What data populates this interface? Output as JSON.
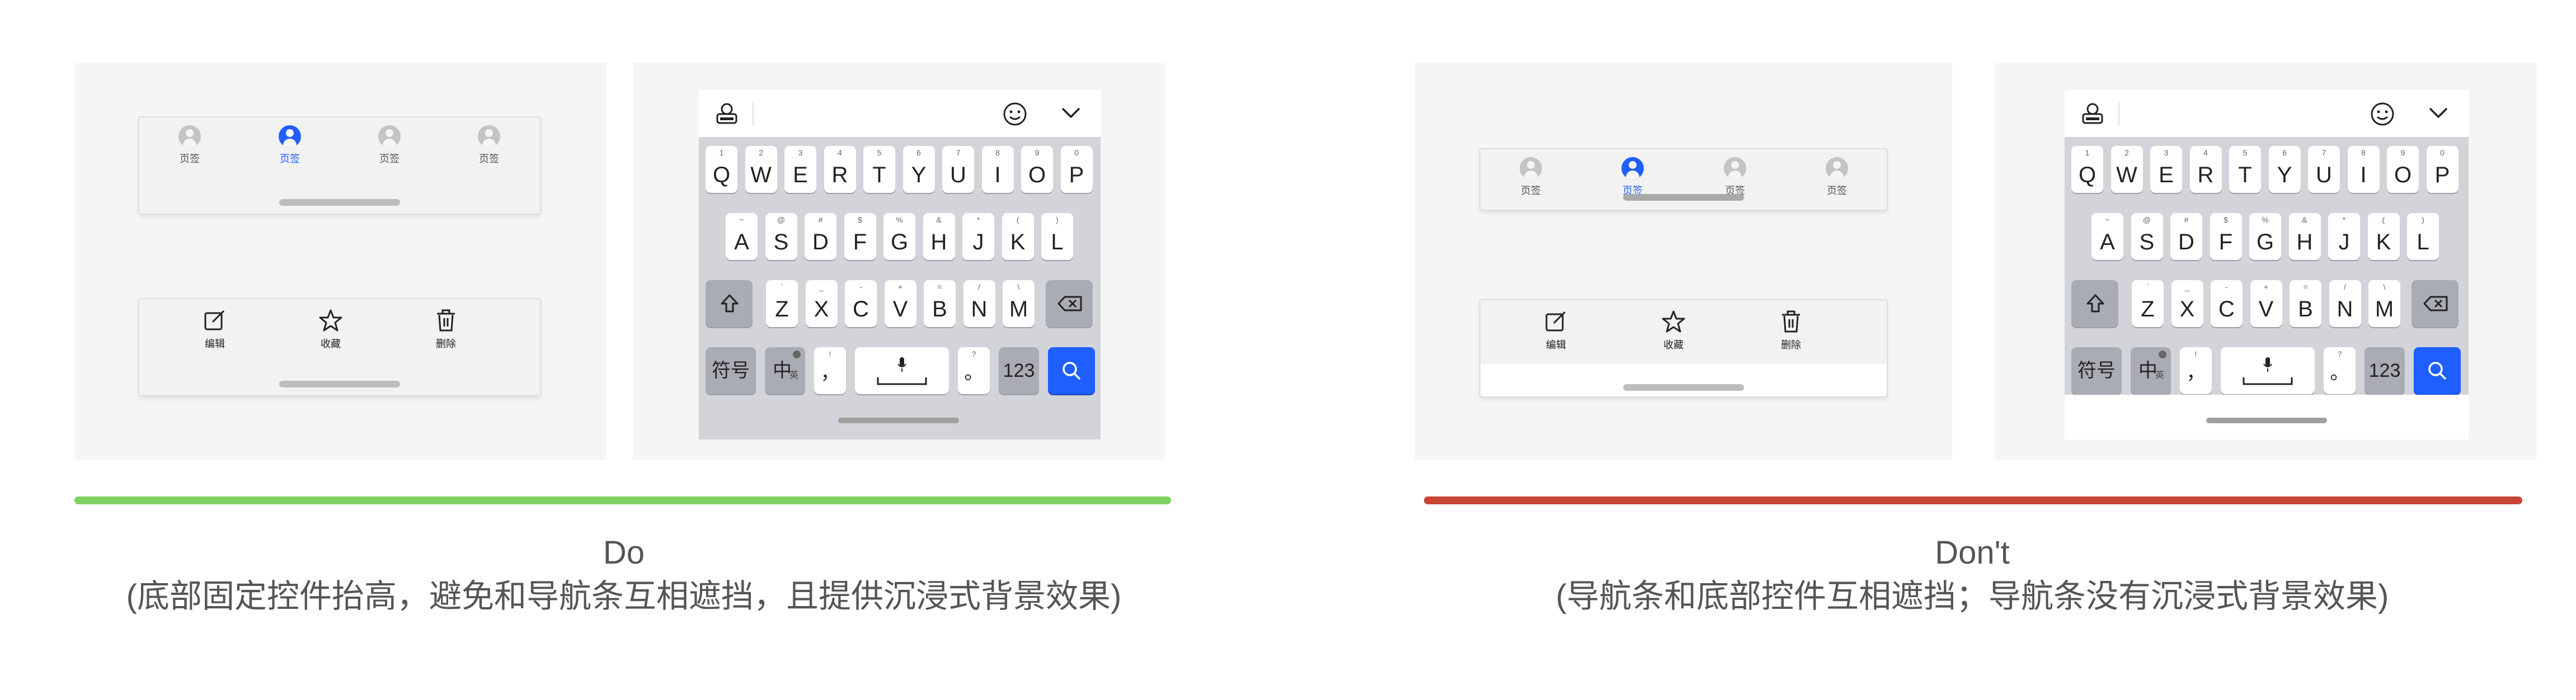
{
  "tab_label": "页签",
  "toolbar": {
    "edit": "编辑",
    "collect": "收藏",
    "delete": "删除"
  },
  "keyboard": {
    "row1": [
      "Q",
      "W",
      "E",
      "R",
      "T",
      "Y",
      "U",
      "I",
      "O",
      "P"
    ],
    "row1_sub": [
      "1",
      "2",
      "3",
      "4",
      "5",
      "6",
      "7",
      "8",
      "9",
      "0"
    ],
    "row2": [
      "A",
      "S",
      "D",
      "F",
      "G",
      "H",
      "J",
      "K",
      "L"
    ],
    "row2_sub": [
      "~",
      "@",
      "#",
      "$",
      "%",
      "&",
      "*",
      "(",
      ")"
    ],
    "row3": [
      "Z",
      "X",
      "C",
      "V",
      "B",
      "N",
      "M"
    ],
    "row3_sub": [
      "`",
      "_",
      "-",
      "+",
      "=",
      "/",
      "\\"
    ],
    "symbols": "符号",
    "chinese": "中",
    "chinese_sub": "英",
    "comma": "，",
    "comma_sub": "!",
    "period": "。",
    "period_sub": "?",
    "numbers": "123",
    "icons": [
      "keyboard-logo-icon",
      "emoji-icon",
      "chevron-down-icon",
      "shift-icon",
      "delete-icon",
      "mic-icon",
      "search-icon",
      "space-icon"
    ]
  },
  "do_panel": {
    "title": "Do",
    "desc": "(底部固定控件抬高，避免和导航条互相遮挡，且提供沉浸式背景效果)",
    "color": "#7ed05f"
  },
  "dont_panel": {
    "title": "Don't",
    "desc": "(导航条和底部控件互相遮挡；导航条没有沉浸式背景效果)",
    "color": "#c84536"
  },
  "accent_color": "#1f5eff"
}
